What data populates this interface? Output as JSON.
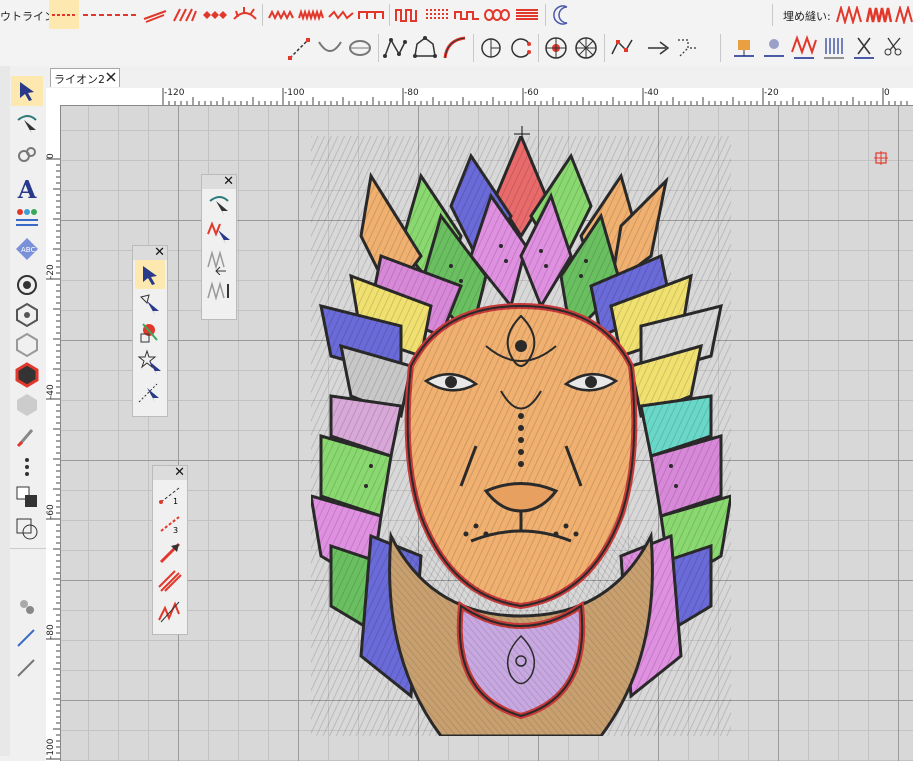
{
  "toolbar_top": {
    "outline_label": "ウトライン:",
    "fill_label": "埋め縫い:"
  },
  "document": {
    "tab_label": "ライオン2",
    "tab_close_icon": "close-icon"
  },
  "rulers": {
    "horizontal_ticks": [
      "-120",
      "-100",
      "-80",
      "-60",
      "-40",
      "-20",
      "0"
    ],
    "vertical_ticks": [
      "0",
      "-20",
      "-40",
      "-60",
      "-80",
      "-100"
    ]
  },
  "palettes": [
    {
      "name": "outline-select-palette",
      "tools": [
        "outline-arrow-icon",
        "stitch-arrow-icon",
        "fill-arrow-icon",
        "fill-direction-icon"
      ]
    },
    {
      "name": "select-palette",
      "tools": [
        "select-arrow-icon",
        "node-arrow-icon",
        "color-arrow-icon",
        "star-arrow-icon",
        "dotted-arrow-icon"
      ]
    },
    {
      "name": "line-palette",
      "tools": [
        "line-1-icon",
        "line-3-icon",
        "arrow-line-icon",
        "zigzag-line-icon",
        "zigzag-fill-icon"
      ]
    }
  ],
  "colors": {
    "accent": "#e2382b",
    "selected_bg": "#fde9b0",
    "canvas": "#d8d8d8",
    "grid_major": "#9a9a9a"
  },
  "design": {
    "name": "lion-embroidery-icon"
  }
}
